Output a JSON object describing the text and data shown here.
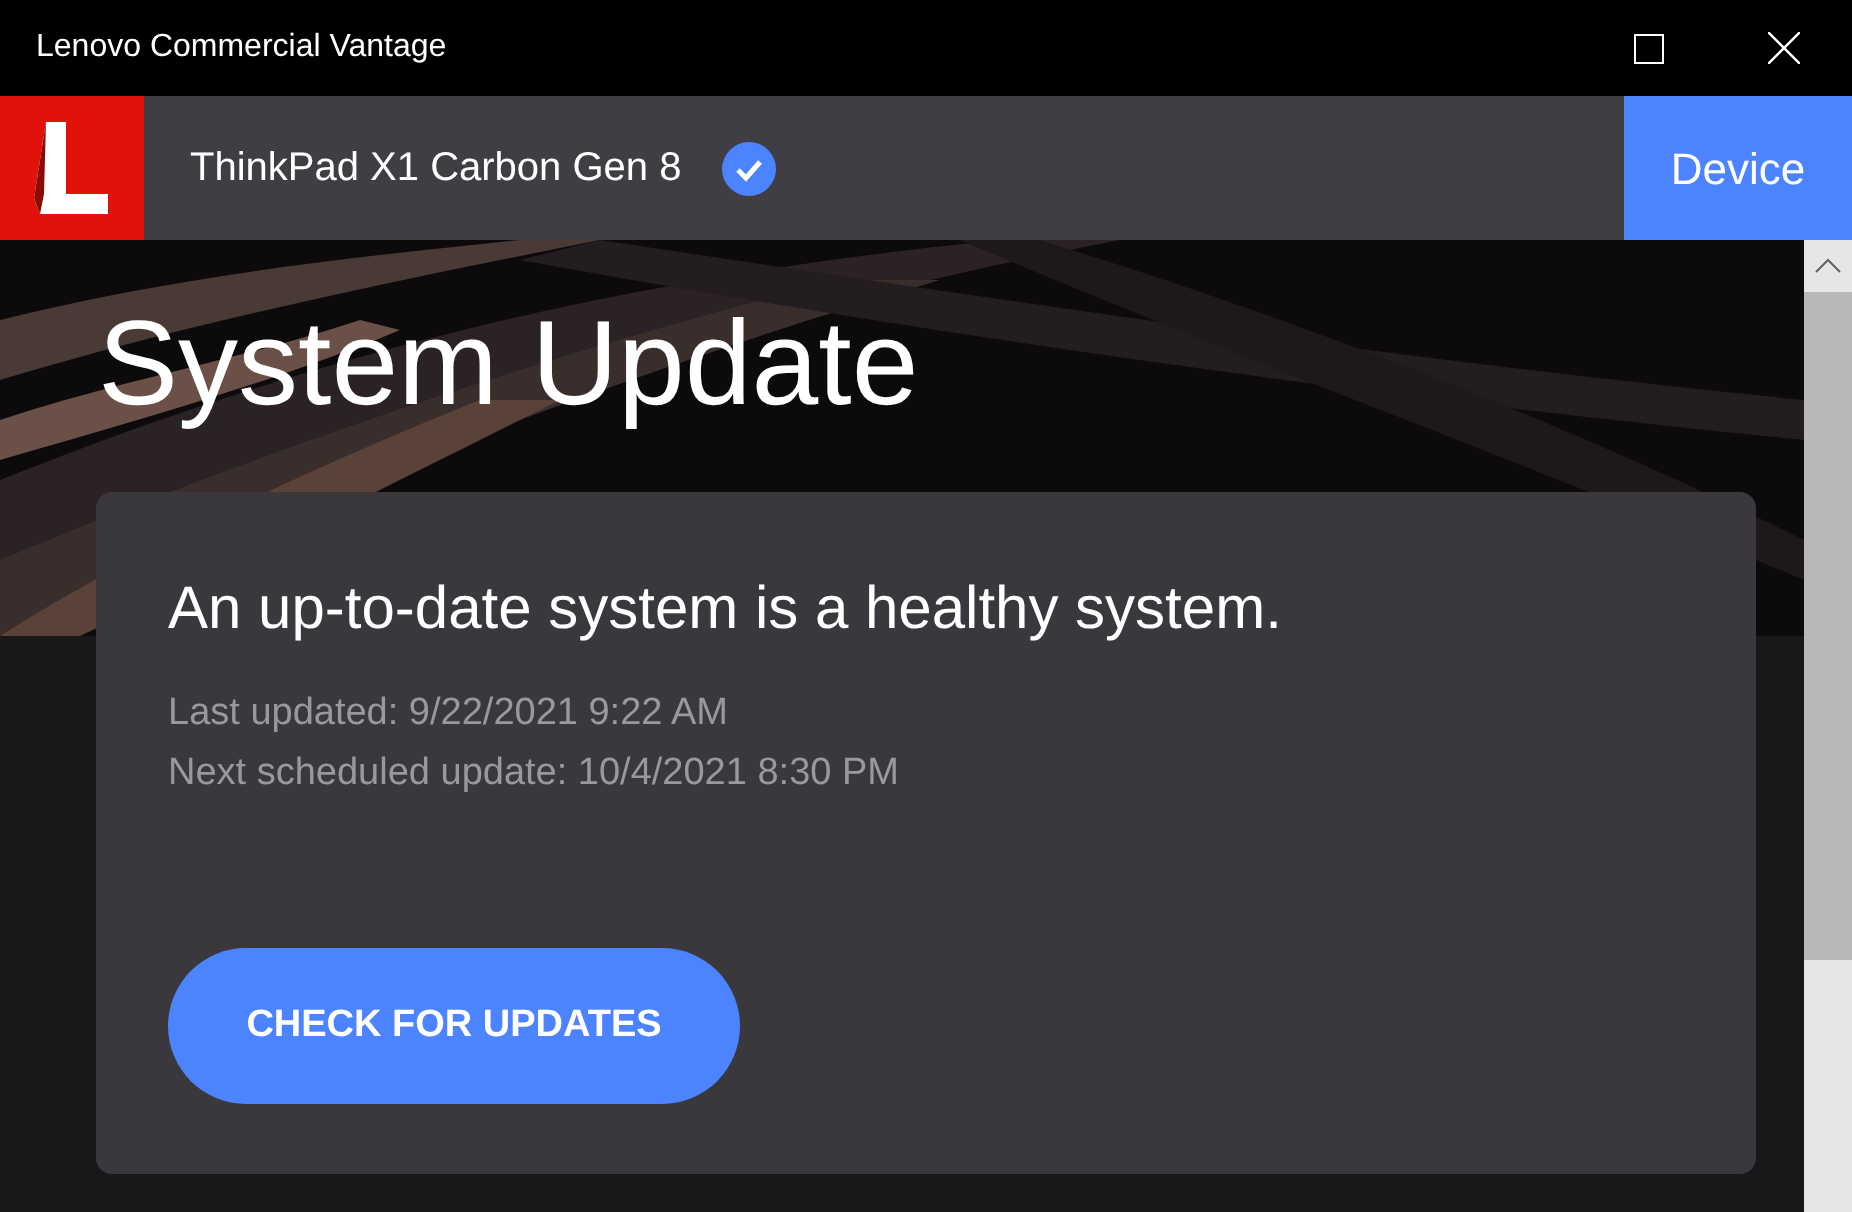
{
  "window": {
    "title": "Lenovo Commercial Vantage"
  },
  "header": {
    "device_name": "ThinkPad X1 Carbon Gen 8",
    "verified": true,
    "nav_button": "Device"
  },
  "hero": {
    "kind": "picture",
    "title": "System Update"
  },
  "card": {
    "headline": "An up-to-date system is a healthy system.",
    "last_updated": "Last updated: 9/22/2021 9:22 AM",
    "next_update": "Next scheduled update: 10/4/2021 8:30 PM",
    "button": "CHECK FOR UPDATES"
  }
}
